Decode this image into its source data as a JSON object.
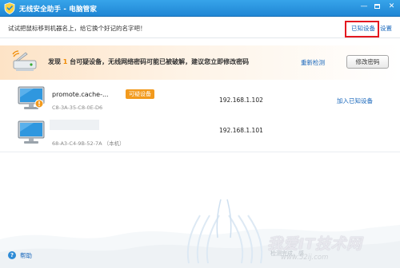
{
  "titlebar": {
    "title": "无线安全助手 - 电脑管家",
    "minimize_glyph": "—",
    "close_glyph": "✕"
  },
  "hintbar": {
    "hint": "试试把鼠标移到机器名上，给它换个好记的名字吧！",
    "known_devices": "已知设备",
    "settings": "设置"
  },
  "alert": {
    "prefix": "发现",
    "count": "1",
    "message": "台可疑设备，无线网络密码可能已被破解，建议您立即修改密码",
    "recheck": "重新检测",
    "change_password": "修改密码"
  },
  "devices": [
    {
      "name": "promote.cache-...",
      "mac": "C8-3A-35-C8-0E-D6",
      "tag": "可疑设备",
      "ip": "192.168.1.102",
      "action": "加入已知设备"
    },
    {
      "name": "",
      "mac": "68-A3-C4-9B-52-7A （本机）",
      "ip": "192.168.1.101"
    }
  ],
  "footer": {
    "help": "帮助"
  },
  "watermark": {
    "text": "我爱IT技术网",
    "sub": "检测完成，感",
    "url": "www.52ij.com"
  },
  "colors": {
    "titlebar": "#2a93dd",
    "link": "#1766bb",
    "accent_orange": "#f29a1d",
    "highlight_red": "#e4181f"
  },
  "icons": {
    "app": "shield-icon",
    "alert": "scanner-alert-icon",
    "device": "computer-monitor-icon",
    "help": "help-icon"
  }
}
